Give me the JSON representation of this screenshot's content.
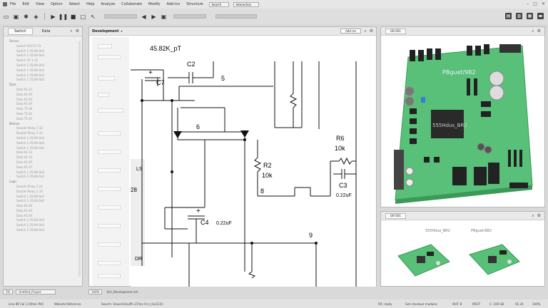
{
  "menu": {
    "items": [
      "File",
      "Edit",
      "View",
      "Option",
      "Select",
      "Help",
      "Analyze",
      "Collaborate",
      "Modify",
      "Add-ins",
      "Structure"
    ],
    "search_label": "Search",
    "field_label": "Interaction"
  },
  "left_panel": {
    "tabs": [
      "Switch",
      "Data"
    ],
    "tree": [
      "Sensor",
      "Switch RSC13-73",
      "Switch 1-25/46-0x0",
      "Switch 1-25/46-0x0",
      "Switch 37-1-31",
      "Switch 1-25/46-0x0",
      "Switch 1-25/46-0x0",
      "Switch 1-25/46-0x0",
      "Switch 1-25/46-0x0",
      "Data",
      "Data K1-11",
      "Data K1-81",
      "Data K1-87",
      "Data K1-87",
      "Data T1-46",
      "Data T1-81",
      "Data T1-41",
      "Module",
      "Double Relay 1-32",
      "Double Relay 1-33",
      "Switch 1-25/46-0x0",
      "Switch 1-25/46-0x0",
      "Switch 1-25/46-0x0",
      "Data K1-12",
      "Data K1-12",
      "Data K1-87",
      "Data K1-47",
      "Switch 1-25/46-0x0",
      "Switch 1-25/46-0x0",
      "Logic",
      "Double Relay 1-22",
      "Double Relay 1-33",
      "Switch 1-25/46-0x0",
      "Switch 1-25/46-0x0",
      "Data K1-81",
      "Data K1-81",
      "Data K1-81",
      "Switch 1-25/46-0x0",
      "Switch 1-25/46-0x0",
      "Switch 1-25/46-0x0"
    ],
    "footer_left": "1%",
    "footer_right": "Untitled_Project"
  },
  "editor": {
    "title": "Development",
    "add_label": "Add res",
    "footer_left": "100%",
    "footer_right": "Sch_Development.sch",
    "schematic": {
      "header": "45.82K_pT",
      "labels": {
        "c7": "C7",
        "c2": "C2",
        "n5": "5",
        "n6": "6",
        "r6": "R6",
        "r6v": "10k",
        "r2": "R2",
        "r2v": "10k",
        "n8": "8",
        "c3": "C3",
        "c3v": "0.22uF",
        "c4": "C4",
        "c4v": "0.22uF",
        "n9": "9",
        "ls": "LS",
        "dr": "DR",
        "n28": "28",
        "plus1": "+",
        "plus2": "+"
      }
    }
  },
  "viewport3d": {
    "tab": "GR-561",
    "board_label1": "PBguet/982",
    "board_label2": "555Hdus_BR2"
  },
  "thumbnails": {
    "tab": "GR-561",
    "items": [
      {
        "label": "555Hdus_BR2"
      },
      {
        "label": "PBguet/982"
      }
    ]
  },
  "status": {
    "items": [
      "Line 89 Col 1  [Other PH]",
      "Website Reference",
      "Search: View.InGhu/Ph 27/mv 0:nr_0u(LCO)"
    ],
    "right_items": [
      "RX: ready",
      "Get checkout modules",
      "OHT: 8",
      "RROT",
      "C: 100 GB",
      "01:24",
      "100%"
    ]
  },
  "colors": {
    "pcb_green": "#58c078",
    "pcb_dark": "#3c9a58",
    "accent": "#333333"
  }
}
